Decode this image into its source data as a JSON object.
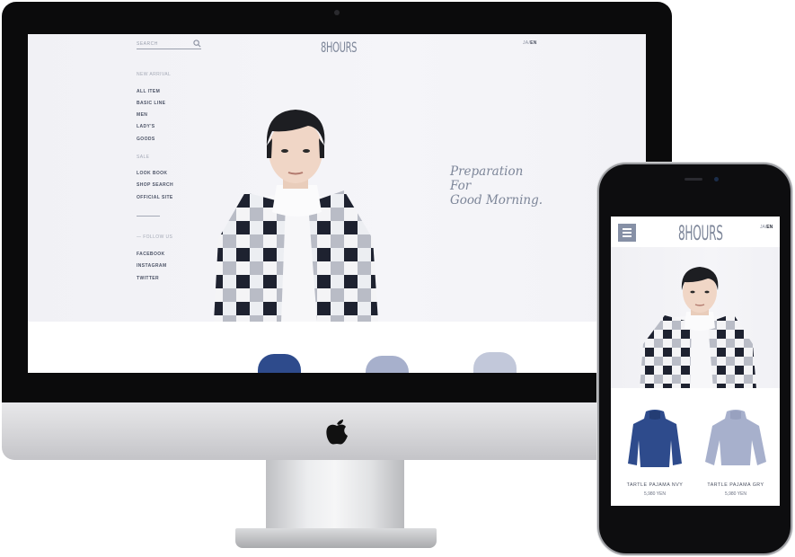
{
  "desktop": {
    "search": {
      "placeholder": "SEARCH"
    },
    "brand": "8HOURS",
    "lang": {
      "ja": "JA",
      "sep": "/",
      "en": "EN"
    },
    "nav": {
      "new_arrival": "NEW ARRIVAL",
      "all_item": "ALL ITEM",
      "basic_line": "BASIC LINE",
      "men": "MEN",
      "ladys": "LADY'S",
      "goods": "GOODS",
      "sale": "SALE",
      "look_book": "LOOK BOOK",
      "shop_search": "SHOP SEARCH",
      "official_site": "OFFICIAL SITE",
      "follow_us": "— FOLLOW US",
      "facebook": "FACEBOOK",
      "instagram": "INSTAGRAM",
      "twitter": "TWITTER"
    },
    "tagline": {
      "line1": "Preparation",
      "line2": "For",
      "line3": "Good Morning."
    }
  },
  "mobile": {
    "brand": "8HOURS",
    "lang": {
      "ja": "JA",
      "sep": "/",
      "en": "EN"
    },
    "products": [
      {
        "name": "TARTLE PAJAMA NVY",
        "price": "5,980 YEN"
      },
      {
        "name": "TARTLE PAJAMA GRY",
        "price": "5,980 YEN"
      }
    ]
  },
  "icons": {
    "search": "search-icon",
    "menu": "hamburger-menu-icon",
    "apple": "apple-logo-icon"
  },
  "colors": {
    "brand_text": "#7d8699",
    "menu_button": "#8690a6",
    "nav_text": "#4c5366",
    "nav_heading": "#a4a9b6",
    "sweater_navy": "#2e4b8c",
    "sweater_gray": "#a7b0cc"
  }
}
